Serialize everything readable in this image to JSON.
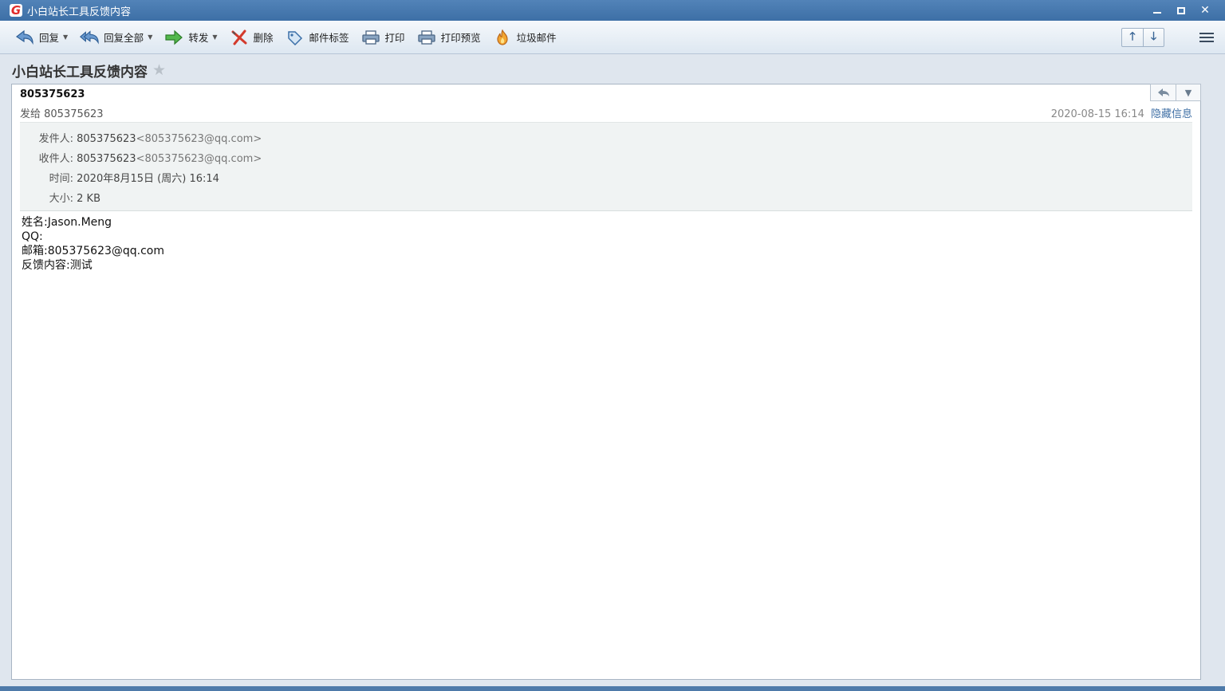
{
  "window": {
    "title": "小白站长工具反馈内容",
    "logo_letter": "G",
    "min_icon": "minimize-icon",
    "max_icon": "maximize-icon",
    "close_icon": "close-icon",
    "close_glyph": "✕"
  },
  "toolbar": {
    "reply": "回复",
    "reply_all": "回复全部",
    "forward": "转发",
    "delete": "删除",
    "tag": "邮件标签",
    "print": "打印",
    "print_preview": "打印预览",
    "spam": "垃圾邮件",
    "prev_glyph": "🡑",
    "next_glyph": "🡓"
  },
  "subject": {
    "text": "小白站长工具反馈内容",
    "star_glyph": "★"
  },
  "mail": {
    "sender_name": "805375623",
    "sent_to": "发给 805375623",
    "date": "2020-08-15 16:14",
    "hide_info": "隐藏信息",
    "details": {
      "from_label": "发件人:",
      "from_name": "805375623",
      "from_addr": "<805375623@qq.com>",
      "to_label": "收件人:",
      "to_name": "805375623",
      "to_addr": "<805375623@qq.com>",
      "time_label": "时间:",
      "time_value": "2020年8月15日 (周六) 16:14",
      "size_label": "大小:",
      "size_value": "2 KB"
    },
    "body": [
      "姓名:Jason.Meng",
      "QQ:",
      "邮箱:805375623@qq.com",
      "反馈内容:测试"
    ]
  },
  "colors": {
    "titlebar": "#4775ab",
    "accent_link": "#3f6fa5",
    "delete_red": "#d33a2c",
    "forward_green": "#3fa63a"
  }
}
